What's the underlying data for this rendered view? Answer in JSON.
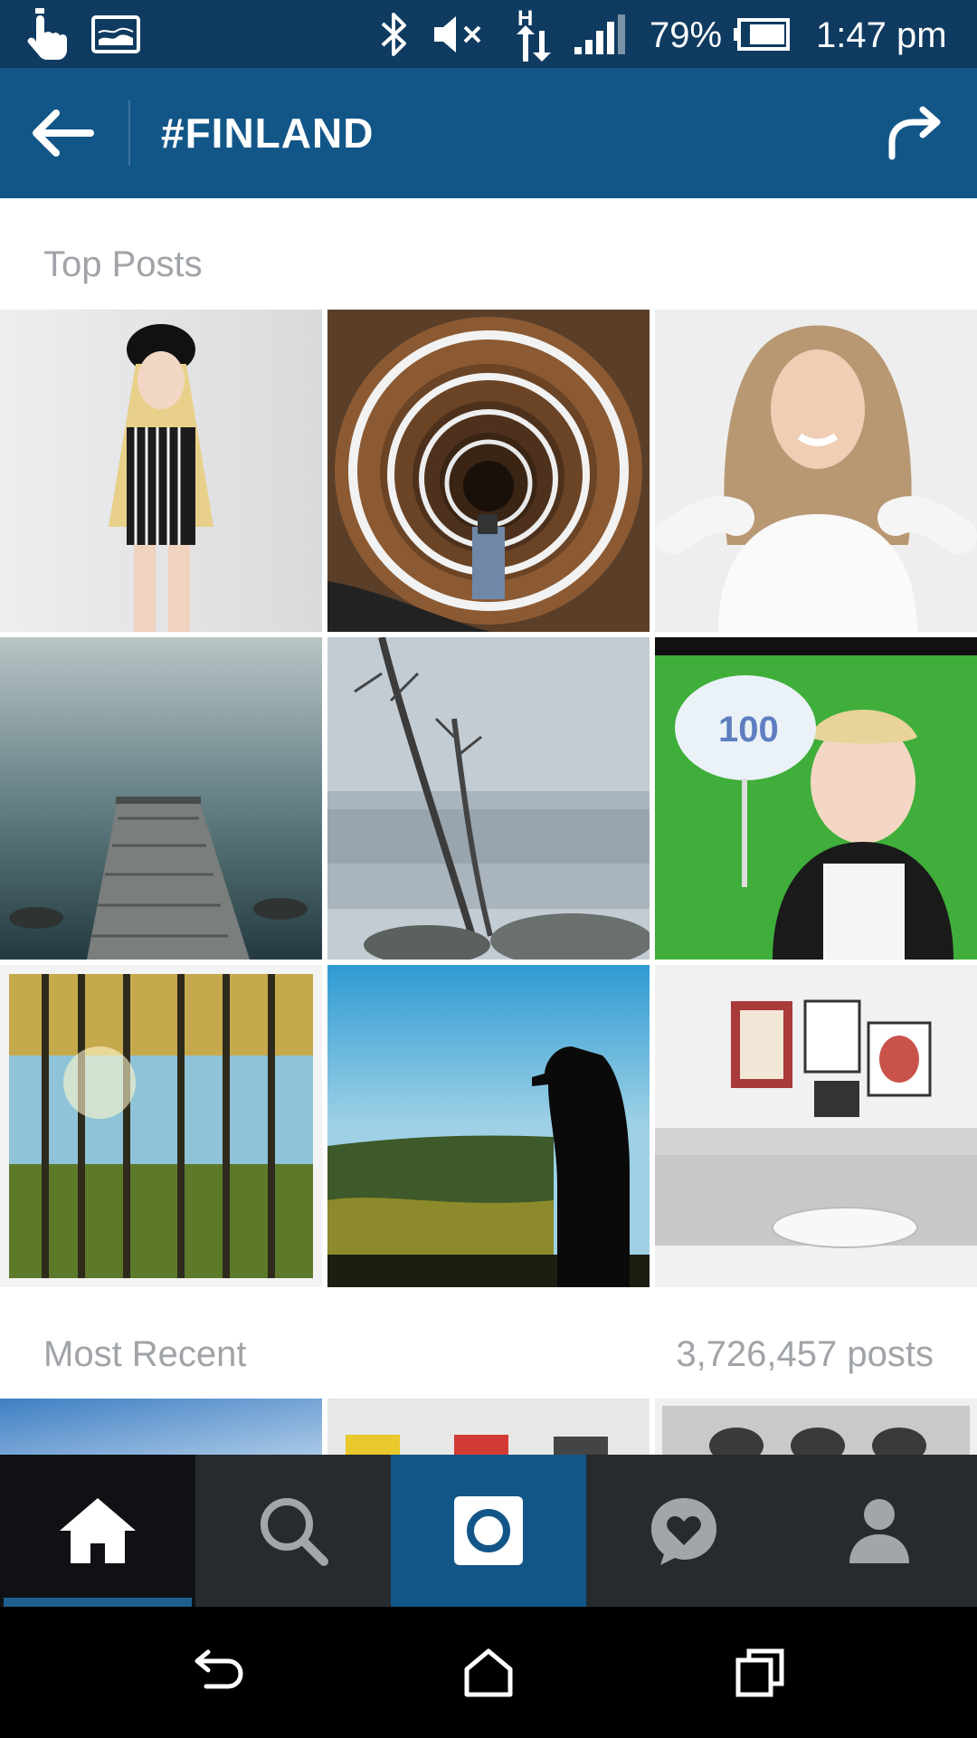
{
  "status_bar": {
    "battery_percent": "79%",
    "time": "1:47 pm",
    "icons": [
      "touch-icon",
      "image-icon",
      "bluetooth-icon",
      "mute-icon",
      "h-data-icon",
      "signal-icon",
      "battery-icon"
    ]
  },
  "app_bar": {
    "title": "#FINLAND",
    "back_icon": "arrow-left-icon",
    "share_icon": "share-arrow-icon"
  },
  "top_posts": {
    "label": "Top Posts",
    "posts": [
      {
        "subject": "woman-in-striped-romper"
      },
      {
        "subject": "spiral-staircase"
      },
      {
        "subject": "smiling-woman-white-sweater"
      },
      {
        "subject": "misty-pier"
      },
      {
        "subject": "foggy-trees"
      },
      {
        "subject": "woman-holding-sign"
      },
      {
        "subject": "autumn-forest"
      },
      {
        "subject": "photographer-silhouette"
      },
      {
        "subject": "living-room-sofa"
      }
    ]
  },
  "most_recent": {
    "label": "Most Recent",
    "count": "3,726,457 posts"
  },
  "bottom_nav": {
    "items": [
      {
        "icon": "home-icon",
        "active": true
      },
      {
        "icon": "search-icon",
        "active": false
      },
      {
        "icon": "camera-icon",
        "active": false
      },
      {
        "icon": "activity-heart-icon",
        "active": false
      },
      {
        "icon": "profile-icon",
        "active": false
      }
    ]
  },
  "system_nav": {
    "icons": [
      "back-icon",
      "home-outline-icon",
      "recents-icon"
    ]
  },
  "colors": {
    "status_bar": "#0f3b61",
    "app_bar": "#125688",
    "nav_bg": "#262b30",
    "nav_active": "#0f1114",
    "section_text": "#a0a4a8"
  }
}
